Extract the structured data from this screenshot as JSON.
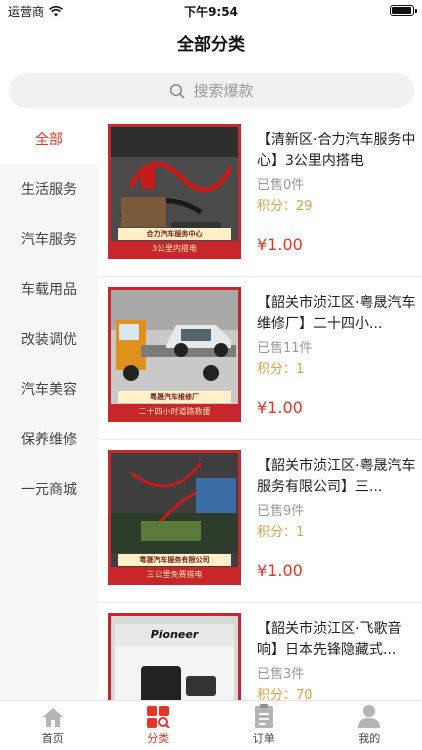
{
  "status_bar": {
    "carrier": "运营商",
    "time": "下午9:54"
  },
  "header": {
    "title": "全部分类"
  },
  "search": {
    "placeholder": "搜索爆款"
  },
  "sidebar": {
    "items": [
      {
        "label": "全部",
        "active": true
      },
      {
        "label": "生活服务"
      },
      {
        "label": "汽车服务"
      },
      {
        "label": "车载用品"
      },
      {
        "label": "改装调优"
      },
      {
        "label": "汽车美容"
      },
      {
        "label": "保养维修"
      },
      {
        "label": "一元商城"
      }
    ]
  },
  "products": [
    {
      "title": "【清新区·合力汽车服务中心】3公里内搭电",
      "sold": "已售0件",
      "points": "积分：29",
      "price": "¥1.00",
      "img_caption": "合力汽车服务中心",
      "img_subcaption": "3公里内搭电"
    },
    {
      "title": "【韶关市浈江区·粤晟汽车维修厂】二十四小...",
      "sold": "已售11件",
      "points": "积分：1",
      "price": "¥1.00",
      "img_caption": "粤晟汽车维修厂",
      "img_subcaption": "二十四小时道路救援"
    },
    {
      "title": "【韶关市浈江区·粤晟汽车服务有限公司】三...",
      "sold": "已售9件",
      "points": "积分：1",
      "price": "¥1.00",
      "img_caption": "粤晟汽车服务有限公司",
      "img_subcaption": "三公里免费搭电"
    },
    {
      "title": "【韶关市浈江区·飞歌音响】日本先锋隐藏式...",
      "sold": "已售3件",
      "points": "积分：70",
      "price": "",
      "img_caption": "Pioneer",
      "img_subcaption": ""
    }
  ],
  "tabbar": {
    "items": [
      {
        "label": "首页",
        "icon": "home-icon"
      },
      {
        "label": "分类",
        "icon": "category-icon",
        "active": true
      },
      {
        "label": "订单",
        "icon": "order-icon"
      },
      {
        "label": "我的",
        "icon": "profile-icon"
      }
    ]
  },
  "colors": {
    "accent": "#e4352a",
    "points": "#d9a449",
    "thumb_border": "#c8262a"
  }
}
